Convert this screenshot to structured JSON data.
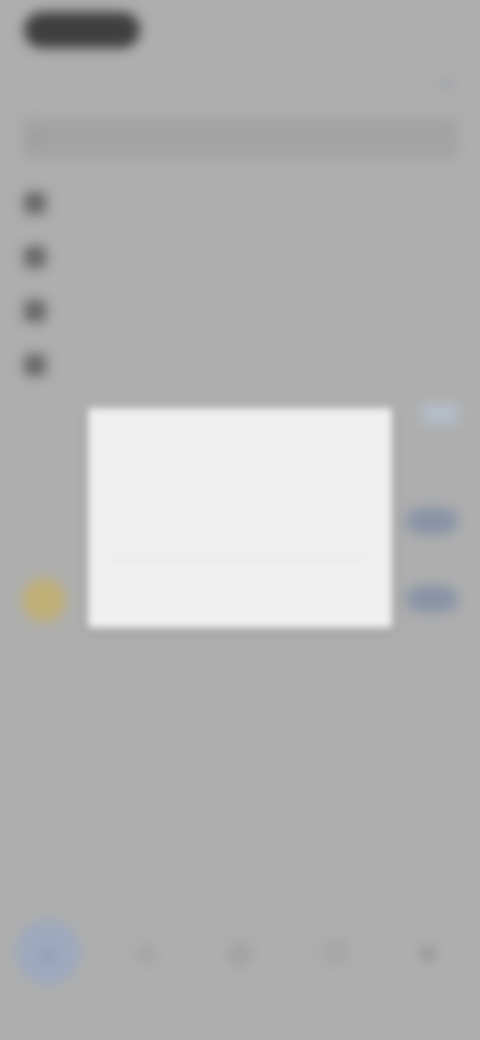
{
  "status": {
    "left_pill": "",
    "right": ""
  },
  "header": {
    "title": "",
    "action_icon": "add-icon"
  },
  "search": {
    "placeholder": ""
  },
  "menu": {
    "items": [
      {
        "label": "",
        "icon": "lock-icon"
      },
      {
        "label": "",
        "icon": "contacts-icon"
      },
      {
        "label": "",
        "icon": "archive-icon"
      },
      {
        "label": "",
        "icon": "settings-icon"
      }
    ]
  },
  "list": {
    "rows": [
      {
        "label": ""
      },
      {
        "label": "",
        "badge": ""
      },
      {
        "label": "",
        "badge": "",
        "avatar_color": "#c8b67a"
      }
    ]
  },
  "dialog": {
    "title": "",
    "message": "",
    "input_placeholder": "",
    "cancel_label": "",
    "ok_label": ""
  },
  "tabbar": {
    "tabs": [
      {
        "icon": "home-icon",
        "active": true
      },
      {
        "icon": "contacts-icon",
        "active": false
      },
      {
        "icon": "camera-icon",
        "active": false
      },
      {
        "icon": "chat-icon",
        "active": false
      },
      {
        "icon": "profile-icon",
        "active": false
      }
    ]
  },
  "colors": {
    "accent": "#5b8fd0",
    "background": "#b5b5b5",
    "dialog_bg": "#f0f0f0"
  }
}
